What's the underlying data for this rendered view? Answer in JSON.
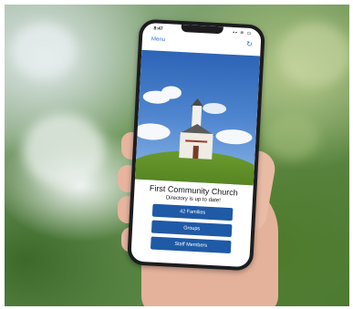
{
  "status_bar": {
    "time": "8:47",
    "icons": "▪▪ ≋ ▭"
  },
  "nav": {
    "menu_label": "Menu",
    "refresh_icon": "↻"
  },
  "content": {
    "title": "First Community Church",
    "subtitle": "Directory is up to date!",
    "buttons": [
      "42 Families",
      "Groups",
      "Staff Members"
    ]
  },
  "colors": {
    "accent": "#2a6fdb",
    "button": "#1f5aa6"
  }
}
